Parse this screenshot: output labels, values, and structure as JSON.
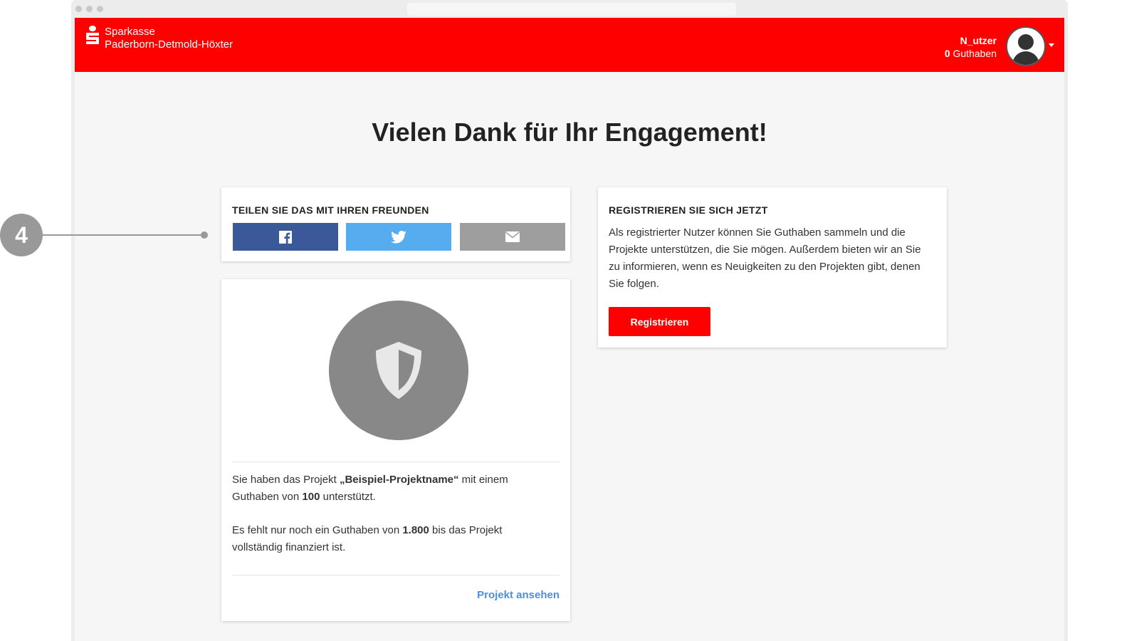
{
  "header": {
    "brand_line1": "Sparkasse",
    "brand_line2": "Paderborn-Detmold-Höxter",
    "user_name": "N_utzer",
    "credits_value": "0",
    "credits_label": "Guthaben"
  },
  "main": {
    "title": "Vielen Dank für Ihr Engagement!"
  },
  "share": {
    "title": "TEILEN SIE DAS MIT IHREN FREUNDEN",
    "buttons": [
      {
        "icon": "facebook-icon",
        "color": "#3b5998"
      },
      {
        "icon": "twitter-icon",
        "color": "#55acee"
      },
      {
        "icon": "mail-icon",
        "color": "#9e9e9e"
      }
    ]
  },
  "project": {
    "icon": "shield-icon",
    "text1_a": "Sie haben das Projekt ",
    "project_name": "„Beispiel-Projektname“",
    "text1_b": " mit einem Guthaben von ",
    "amount": "100",
    "text1_c": " unterstützt.",
    "text2_a": "Es fehlt nur noch ein Guthaben von ",
    "remaining": "1.800",
    "text2_b": " bis das Projekt vollständig finanziert ist.",
    "link": "Projekt ansehen"
  },
  "register": {
    "title": "REGISTRIEREN SIE SICH JETZT",
    "text": "Als registrierter Nutzer können Sie Guthaben sammeln und die Projekte unterstützen, die Sie mögen. Außerdem bieten wir an Sie zu informieren, wenn es Neuigkeiten zu den Projekten gibt, denen Sie folgen.",
    "button": "Registrieren"
  },
  "callout": {
    "number": "4"
  },
  "colors": {
    "brand_red": "#ff0000",
    "link_blue": "#4a90e2"
  }
}
